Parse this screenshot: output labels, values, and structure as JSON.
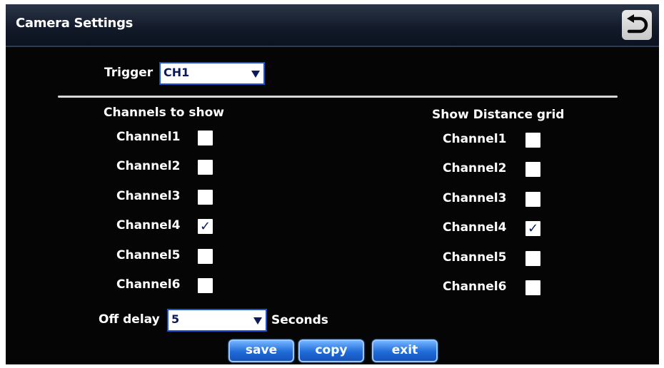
{
  "header": {
    "title": "Camera Settings",
    "back_icon": "back-arrow-icon"
  },
  "trigger": {
    "label": "Trigger",
    "value": "CH1"
  },
  "channels_to_show": {
    "heading": "Channels to show",
    "items": [
      {
        "label": "Channel1",
        "checked": false
      },
      {
        "label": "Channel2",
        "checked": false
      },
      {
        "label": "Channel3",
        "checked": false
      },
      {
        "label": "Channel4",
        "checked": true
      },
      {
        "label": "Channel5",
        "checked": false
      },
      {
        "label": "Channel6",
        "checked": false
      }
    ]
  },
  "distance_grid": {
    "heading": "Show Distance grid",
    "items": [
      {
        "label": "Channel1",
        "checked": false
      },
      {
        "label": "Channel2",
        "checked": false
      },
      {
        "label": "Channel3",
        "checked": false
      },
      {
        "label": "Channel4",
        "checked": true
      },
      {
        "label": "Channel5",
        "checked": false
      },
      {
        "label": "Channel6",
        "checked": false
      }
    ]
  },
  "off_delay": {
    "label": "Off delay",
    "value": "5",
    "unit": "Seconds"
  },
  "buttons": {
    "save": "save",
    "copy": "copy",
    "exit": "exit"
  },
  "check_mark": "✓"
}
